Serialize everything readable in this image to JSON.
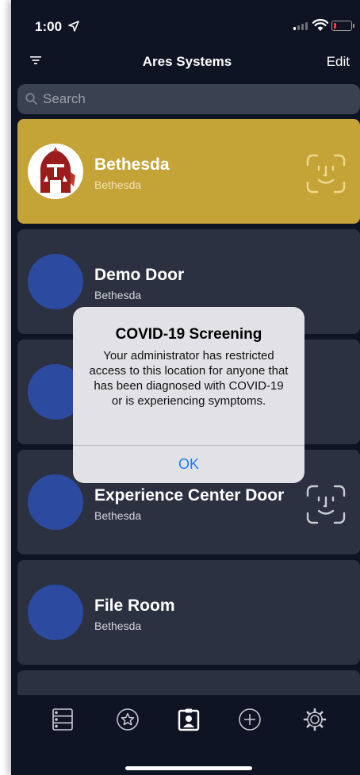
{
  "status_bar": {
    "time": "1:00",
    "battery_level": 0.15,
    "battery_color": "#ff3b30"
  },
  "nav": {
    "title": "Ares Systems",
    "edit_label": "Edit",
    "filter_icon": "filter-icon"
  },
  "search": {
    "placeholder": "Search",
    "value": ""
  },
  "doors": [
    {
      "name": "Bethesda",
      "location": "Bethesda",
      "selected": true,
      "avatar": "ares-logo",
      "face_id": true
    },
    {
      "name": "Demo Door",
      "location": "Bethesda",
      "selected": false,
      "avatar": "blue-circle",
      "face_id": false
    },
    {
      "name": "",
      "location": "",
      "selected": false,
      "avatar": "blue-circle",
      "face_id": false
    },
    {
      "name": "Experience Center Door",
      "location": "Bethesda",
      "selected": false,
      "avatar": "blue-circle",
      "face_id": true
    },
    {
      "name": "File Room",
      "location": "Bethesda",
      "selected": false,
      "avatar": "blue-circle",
      "face_id": false
    }
  ],
  "alert": {
    "title": "COVID-19 Screening",
    "message": "Your administrator has restricted access to this location for anyone that has been diagnosed with COVID-19 or is experiencing symptoms.",
    "ok_label": "OK"
  },
  "tab_bar": {
    "tabs": [
      {
        "icon": "server-list-icon"
      },
      {
        "icon": "star-circle-icon"
      },
      {
        "icon": "badge-icon"
      },
      {
        "icon": "plus-circle-icon"
      },
      {
        "icon": "gear-icon"
      }
    ]
  },
  "colors": {
    "background": "#0e1424",
    "card": "#2b3140",
    "card_selected": "#c4a437",
    "avatar": "#2c4aa0",
    "alert_button": "#1a7cff"
  }
}
